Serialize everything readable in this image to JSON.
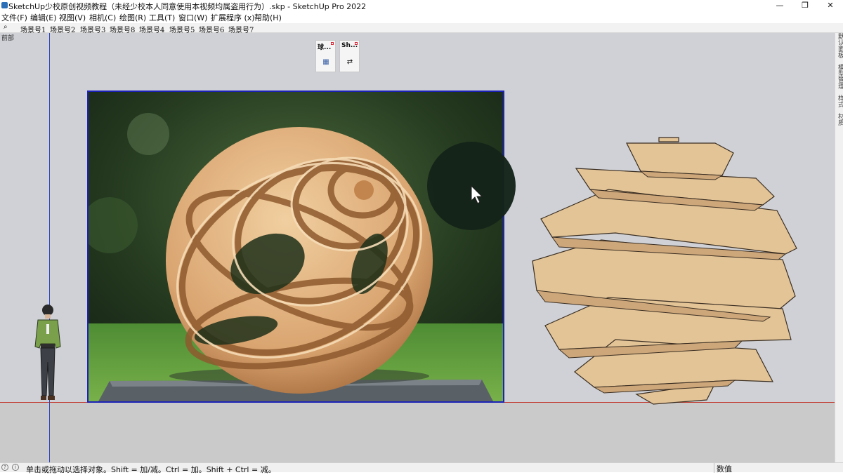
{
  "window": {
    "title": "SketchUp少校原创视频教程（未经少校本人同意使用本视频均属盗用行为）.skp - SketchUp Pro 2022",
    "minimize": "—",
    "maximize": "❐",
    "close": "✕"
  },
  "menu": [
    "文件(F)",
    "编辑(E)",
    "视图(V)",
    "相机(C)",
    "绘图(R)",
    "工具(T)",
    "窗口(W)",
    "扩展程序 (x)",
    "帮助(H)"
  ],
  "scenes": [
    "场景号1",
    "场景号2",
    "场景号3",
    "场景号8",
    "场景号4",
    "场景号5",
    "场景号6",
    "场景号7"
  ],
  "viewport": {
    "view_label": "前部"
  },
  "toolbars": [
    {
      "title": "球...",
      "button_icon": "▦"
    },
    {
      "title": "Sh...",
      "button_icon": "⇄"
    }
  ],
  "right_panel": {
    "tabs": [
      "默认面板",
      "模型管理",
      "样式",
      "材质"
    ]
  },
  "status": {
    "hint": "单击或拖动以选择对象。Shift = 加/减。Ctrl = 加。Shift + Ctrl = 减。",
    "measurements_label": "数值"
  },
  "icons": {
    "app": "sketchup-logo-icon",
    "search": "search-icon",
    "geo": "geolocation-icon",
    "info": "info-icon",
    "cursor": "mouse-cursor-icon"
  },
  "colors": {
    "accent_blue": "#1c22b5",
    "red_axis": "#c03a30",
    "sky": "#cfd1d6",
    "wood": "#e3c497"
  }
}
